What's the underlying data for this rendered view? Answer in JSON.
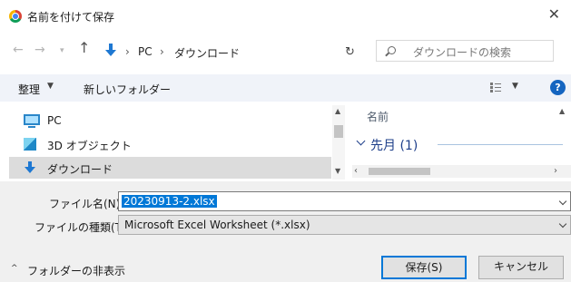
{
  "window": {
    "title": "名前を付けて保存",
    "close_glyph": "✕"
  },
  "nav": {
    "back_glyph": "←",
    "forward_glyph": "→",
    "dropdown_glyph": "▾",
    "up_glyph": "↑",
    "breadcrumb": {
      "sep": "›",
      "pc": "PC",
      "folder": "ダウンロード"
    },
    "refresh_glyph": "↻",
    "search_placeholder": "ダウンロードの検索"
  },
  "toolbar": {
    "organize": "整理",
    "caret": "▼",
    "new_folder": "新しいフォルダー",
    "help": "?"
  },
  "sidebar": {
    "items": [
      {
        "label": "PC",
        "icon": "pc-icon"
      },
      {
        "label": "3D オブジェクト",
        "icon": "cube-icon"
      },
      {
        "label": "ダウンロード",
        "icon": "download-icon",
        "selected": true
      }
    ],
    "scroll_up": "▲",
    "scroll_down": "▼"
  },
  "file_list": {
    "column_name": "名前",
    "group_label": "先月 (1)",
    "scroll_left": "‹",
    "scroll_right": "›",
    "scroll_up": "▲"
  },
  "form": {
    "filename_label": "ファイル名(N):",
    "filename_value": "20230913-2.xlsx",
    "filetype_label": "ファイルの種類(T):",
    "filetype_value": "Microsoft Excel Worksheet (*.xlsx)"
  },
  "footer": {
    "hide_caret": "^",
    "hide_folders": "フォルダーの非表示",
    "save": "保存(S)",
    "cancel": "キャンセル"
  },
  "colors": {
    "accent": "#0078d7",
    "group_text": "#1e3f8a",
    "help_bg": "#1565c0"
  }
}
